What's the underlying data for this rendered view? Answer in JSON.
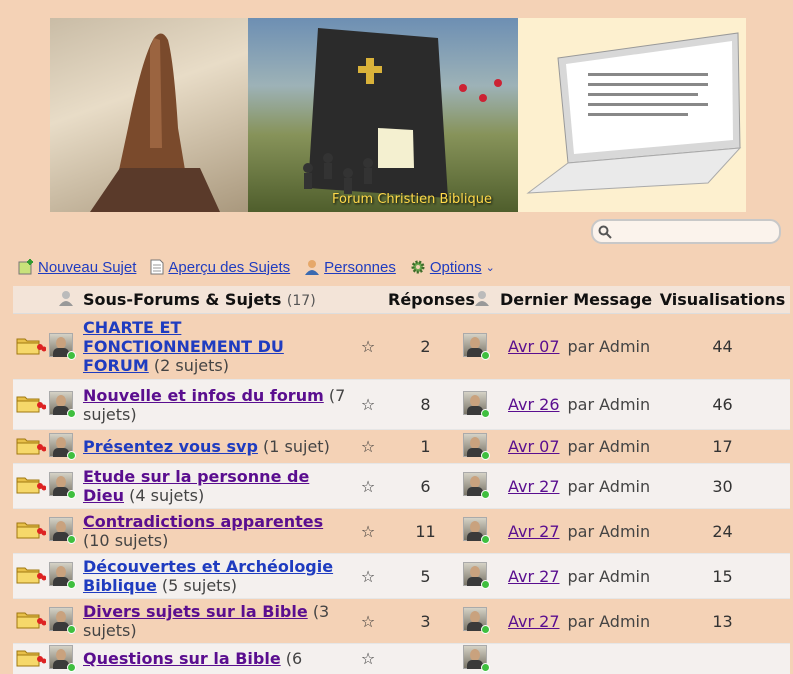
{
  "banner": {
    "caption": "Forum Christien Biblique"
  },
  "search": {
    "placeholder": ""
  },
  "toolbar": {
    "new_topic": "Nouveau Sujet",
    "preview": "Aperçu des Sujets",
    "people": "Personnes",
    "options": "Options"
  },
  "table": {
    "headers": {
      "subforums": "Sous-Forums & Sujets",
      "subforums_count": "(17)",
      "replies": "Réponses",
      "last_message": "Dernier Message",
      "views": "Visualisations"
    },
    "rows": [
      {
        "title": "CHARTE ET FONCTIONNEMENT DU FORUM",
        "count": "(2 sujets)",
        "replies": "2",
        "date": "Avr 07",
        "by": "par Admin",
        "views": "44",
        "blue": true
      },
      {
        "title": "Nouvelle et infos du forum",
        "count": "(7 sujets)",
        "replies": "8",
        "date": "Avr 26",
        "by": "par Admin",
        "views": "46",
        "blue": false
      },
      {
        "title": "Présentez vous svp",
        "count": "(1 sujet)",
        "replies": "1",
        "date": "Avr 07",
        "by": "par Admin",
        "views": "17",
        "blue": true
      },
      {
        "title": "Etude sur la personne de Dieu",
        "count": "(4 sujets)",
        "replies": "6",
        "date": "Avr 27",
        "by": "par Admin",
        "views": "30",
        "blue": false
      },
      {
        "title": "Contradictions apparentes",
        "count": "(10 sujets)",
        "replies": "11",
        "date": "Avr 27",
        "by": "par Admin",
        "views": "24",
        "blue": false
      },
      {
        "title": "Découvertes et Archéologie Biblique",
        "count": "(5 sujets)",
        "replies": "5",
        "date": "Avr 27",
        "by": "par Admin",
        "views": "15",
        "blue": true
      },
      {
        "title": "Divers sujets sur la Bible",
        "count": "(3 sujets)",
        "replies": "3",
        "date": "Avr 27",
        "by": "par Admin",
        "views": "13",
        "blue": false
      },
      {
        "title": "Questions sur la Bible",
        "count": "(6",
        "replies": "",
        "date": "",
        "by": "",
        "views": "",
        "blue": false
      }
    ]
  },
  "colors": {
    "link_purple": "#5a0e8f",
    "link_blue": "#1f3cc0",
    "background": "#f4d2b6"
  }
}
